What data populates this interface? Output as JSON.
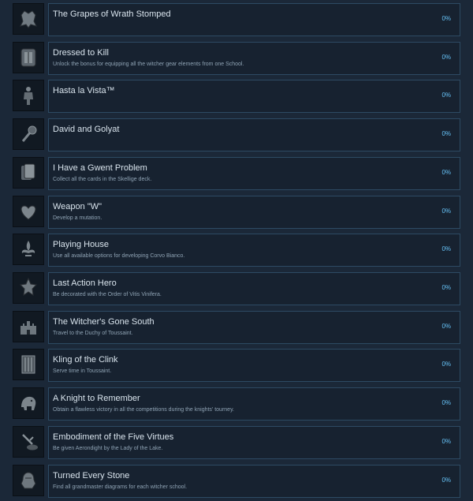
{
  "achievements": [
    {
      "title": "The Grapes of Wrath Stomped",
      "description": "",
      "percent": "0%",
      "icon": "armored-fist-icon"
    },
    {
      "title": "Dressed to Kill",
      "description": "Unlock the bonus for equipping all the witcher gear elements from one School.",
      "percent": "0%",
      "icon": "armor-rack-icon"
    },
    {
      "title": "Hasta la Vista™",
      "description": "",
      "percent": "0%",
      "icon": "robot-figure-icon"
    },
    {
      "title": "David and Golyat",
      "description": "",
      "percent": "0%",
      "icon": "mace-icon"
    },
    {
      "title": "I Have a Gwent Problem",
      "description": "Collect all the cards in the Skellige deck.",
      "percent": "0%",
      "icon": "card-deck-icon"
    },
    {
      "title": "Weapon \"W\"",
      "description": "Develop a mutation.",
      "percent": "0%",
      "icon": "heart-icon"
    },
    {
      "title": "Playing House",
      "description": "Use all available options for developing Corvo Bianco.",
      "percent": "0%",
      "icon": "fleur-de-lis-icon"
    },
    {
      "title": "Last Action Hero",
      "description": "Be decorated with the Order of Vitis Vinifera.",
      "percent": "0%",
      "icon": "medal-icon"
    },
    {
      "title": "The Witcher's Gone South",
      "description": "Travel to the Duchy of Toussaint.",
      "percent": "0%",
      "icon": "castle-icon"
    },
    {
      "title": "Kling of the Clink",
      "description": "Serve time in Toussaint.",
      "percent": "0%",
      "icon": "prison-cell-icon"
    },
    {
      "title": "A Knight to Remember",
      "description": "Obtain a flawless victory in all the competitions during the knights' tourney.",
      "percent": "0%",
      "icon": "elephant-crest-icon"
    },
    {
      "title": "Embodiment of the Five Virtues",
      "description": "Be given Aerondight by the Lady of the Lake.",
      "percent": "0%",
      "icon": "sword-in-stone-icon"
    },
    {
      "title": "Turned Every Stone",
      "description": "Find all grandmaster diagrams for each witcher school.",
      "percent": "0%",
      "icon": "gauntlet-icon"
    }
  ]
}
